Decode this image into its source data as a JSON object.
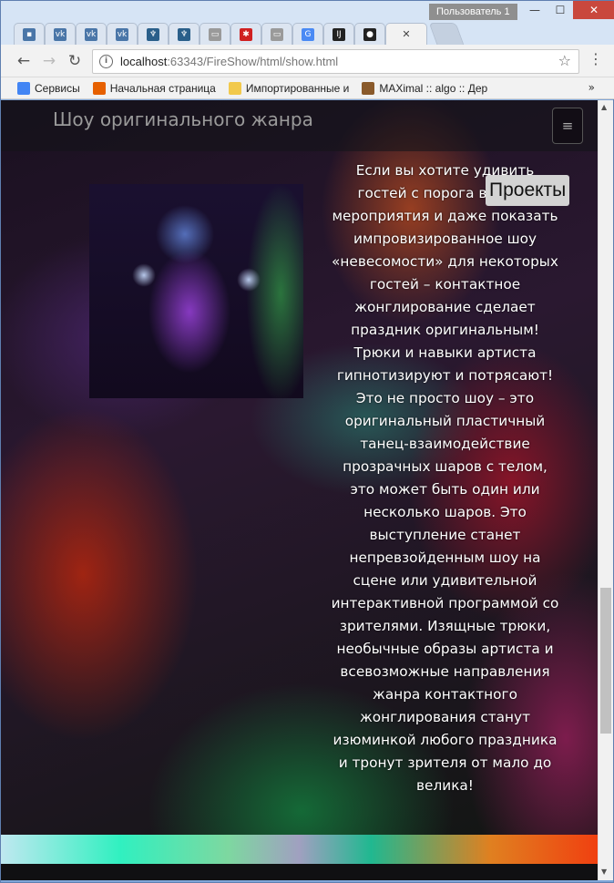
{
  "window": {
    "user_label": "Пользователь 1",
    "min": "—",
    "max": "☐",
    "close": "✕"
  },
  "tabs": [
    {
      "icon": "chat-icon",
      "color": "#4a76a8",
      "glyph": "▪"
    },
    {
      "icon": "vk-icon",
      "color": "#4a76a8",
      "glyph": "vk"
    },
    {
      "icon": "vk-icon",
      "color": "#4a76a8",
      "glyph": "vk"
    },
    {
      "icon": "vk-icon",
      "color": "#4a76a8",
      "glyph": "vk"
    },
    {
      "icon": "person-icon",
      "color": "#2a5f8a",
      "glyph": "♆"
    },
    {
      "icon": "person-icon",
      "color": "#2a5f8a",
      "glyph": "♆"
    },
    {
      "icon": "document-icon",
      "color": "#9a9a9a",
      "glyph": "▭"
    },
    {
      "icon": "star-red-icon",
      "color": "#d02020",
      "glyph": "✱"
    },
    {
      "icon": "document-icon",
      "color": "#9a9a9a",
      "glyph": "▭"
    },
    {
      "icon": "translate-icon",
      "color": "#4a8af4",
      "glyph": "G"
    },
    {
      "icon": "intellij-icon",
      "color": "#222222",
      "glyph": "IJ"
    },
    {
      "icon": "github-icon",
      "color": "#222222",
      "glyph": "●"
    }
  ],
  "active_tab": {
    "close": "✕"
  },
  "toolbar": {
    "back": "←",
    "forward": "→",
    "reload": "↻",
    "url_host": "localhost",
    "url_path": ":63343/FireShow/html/show.html",
    "star": "☆",
    "menu": "⋮"
  },
  "bookmarks": [
    {
      "label": "Сервисы",
      "icon": "apps-grid-icon",
      "color": "#4285f4"
    },
    {
      "label": "Начальная страница",
      "icon": "firefox-icon",
      "color": "#e66000"
    },
    {
      "label": "Импортированные и",
      "icon": "folder-icon",
      "color": "#f2c94c"
    },
    {
      "label": "MAXimal :: algo :: Дер",
      "icon": "maximal-icon",
      "color": "#8a5a2b"
    }
  ],
  "bookmarks_more": "»",
  "page": {
    "brand": "Шоу оригинального жанра",
    "menu_toggle": "≡",
    "badge": "Проекты",
    "story_lines": [
      "Если вы хотите удивить",
      "гостей с порога вашего",
      "мероприятия и даже показать",
      "импровизированное шоу",
      "«невесомости» для некоторых",
      "гостей – контактное",
      "жонглирование сделает",
      "праздник оригинальным!",
      "Трюки и навыки артиста",
      "гипнотизируют и потрясают!",
      "Это не просто шоу – это",
      "оригинальный пластичный",
      "танец-взаимодействие",
      "прозрачных шаров с телом,",
      "это может быть один или",
      "несколько шаров. Это",
      "выступление станет",
      "непревзойденным шоу на",
      "сцене или удивительной",
      "интерактивной программой со",
      "зрителями. Изящные трюки,",
      "необычные образы артиста и",
      "всевозможные направления",
      "жанра контактного",
      "жонглирования станут",
      "изюминкой любого праздника",
      "и тронут зрителя от мало до",
      "велика!"
    ]
  },
  "scrollbar": {
    "up": "▲",
    "down": "▼"
  }
}
